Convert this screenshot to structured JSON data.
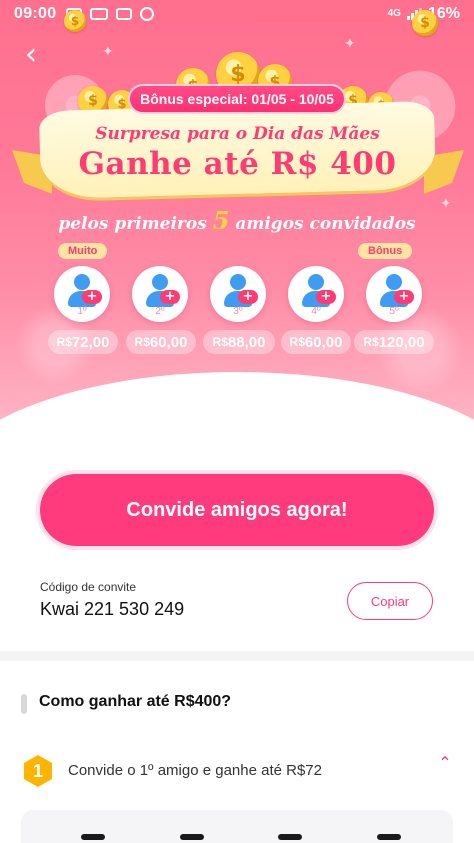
{
  "status_bar": {
    "time": "09:00",
    "network": "4G",
    "battery": "16%",
    "icons": [
      "youtube-icon",
      "app-icon",
      "gallery-icon",
      "sync-icon"
    ]
  },
  "header": {
    "back_icon": "chevron-left-icon",
    "badge": "Bônus especial: 01/05 - 10/05",
    "subtitle": "Surpresa para o Dia das Mães",
    "title": "Ganhe até  R$ 400",
    "tagline_before": "pelos primeiros ",
    "tagline_num": "5",
    "tagline_after": " amigos convidados"
  },
  "tags": {
    "left": "Muito",
    "right": "Bônus"
  },
  "friends": [
    {
      "ordinal": "1º",
      "currency": "R$",
      "amount": "72,00"
    },
    {
      "ordinal": "2º",
      "currency": "R$",
      "amount": "60,00"
    },
    {
      "ordinal": "3º",
      "currency": "R$",
      "amount": "88,00"
    },
    {
      "ordinal": "4º",
      "currency": "R$",
      "amount": "60,00"
    },
    {
      "ordinal": "5º",
      "currency": "R$",
      "amount": "120,00"
    }
  ],
  "cta": {
    "label": "Convide amigos agora!"
  },
  "invite": {
    "label": "Código de convite",
    "code": "Kwai 221 530 249",
    "copy_label": "Copiar"
  },
  "how_to": {
    "title": "Como ganhar até R$400?",
    "step_number": "1",
    "step_text": "Convide o 1º amigo e ganhe até R$72"
  },
  "colors": {
    "accent": "#ff3b7d",
    "hero_top": "#ff6f8e",
    "gold": "#ffd23f"
  }
}
